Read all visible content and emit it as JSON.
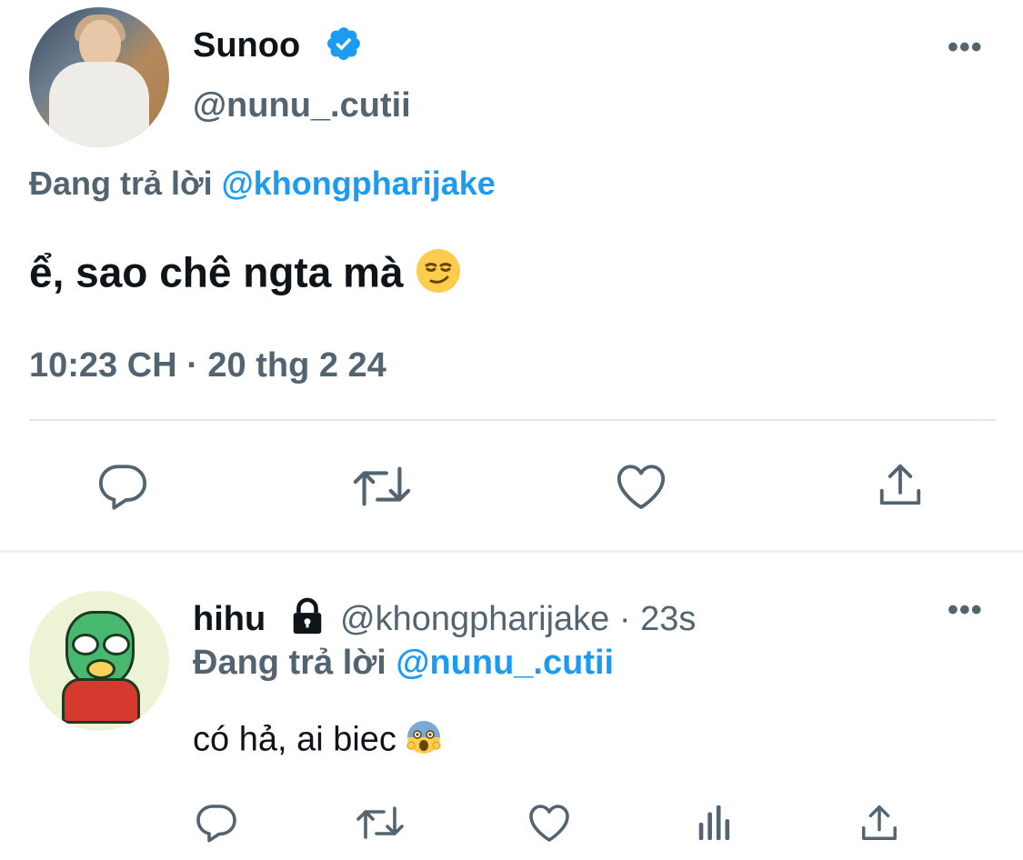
{
  "tweet": {
    "display_name": "Sunoo",
    "handle": "@nunu_.cutii",
    "reply_prefix": "Đang trả lời",
    "reply_to": "@khongpharijake",
    "text": "ể, sao chê ngta mà",
    "text_emoji": "smirking-face",
    "timestamp": "10:23 CH · 20 thg 2 24",
    "icons": {
      "verified": "verified-badge-icon",
      "more": "more-options-icon",
      "actions": [
        "reply-icon",
        "retweet-icon",
        "like-icon",
        "share-icon"
      ]
    }
  },
  "reply": {
    "display_name": "hihu",
    "handle": "@khongpharijake",
    "separator": "·",
    "time": "23s",
    "reply_prefix": "Đang trả lời",
    "reply_to": "@nunu_.cutii",
    "text": "có hả, ai biec",
    "text_emoji": "screaming-face",
    "icons": {
      "lock": "lock-icon",
      "more": "more-options-icon",
      "actions": [
        "reply-icon",
        "retweet-icon",
        "like-icon",
        "analytics-icon",
        "share-icon"
      ]
    }
  },
  "colors": {
    "link": "#1d9bf0",
    "secondary": "#536471",
    "icon": "#536471",
    "text": "#0f1419"
  }
}
